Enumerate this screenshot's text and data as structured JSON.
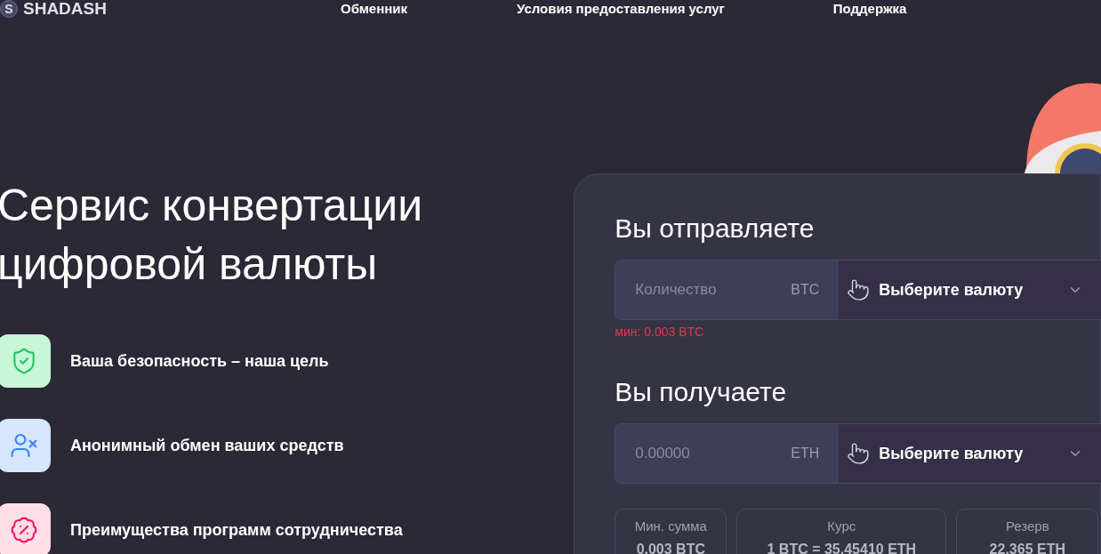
{
  "header": {
    "logo_letter": "S",
    "logo_text": "SHADASH",
    "nav": [
      "Обменник",
      "Условия предоставления услуг",
      "Поддержка"
    ]
  },
  "hero": {
    "title_lines": [
      "Сервис конвертации",
      "цифровой валюты"
    ],
    "features": [
      {
        "kind": "shield",
        "text": "Ваша безопасность – наша цель"
      },
      {
        "kind": "user",
        "text": "Анонимный обмен ваших средств"
      },
      {
        "kind": "percent",
        "text": "Преимущества программ сотрудничества"
      }
    ]
  },
  "exchange": {
    "send": {
      "title": "Вы отправляете",
      "placeholder": "Количество",
      "currency": "BTC",
      "select": "Выберите валюту",
      "hint": "мин: 0.003 BTC"
    },
    "receive": {
      "title": "Вы получаете",
      "placeholder": "0.00000",
      "currency": "ETH",
      "select": "Выберите валюту"
    },
    "stats": [
      {
        "label": "Мин. сумма",
        "value": "0.003 BTC"
      },
      {
        "label": "Курс",
        "value": "1 BTC = 35.45410 ETH"
      },
      {
        "label": "Резерв",
        "value": "22.365 ETH"
      }
    ]
  }
}
